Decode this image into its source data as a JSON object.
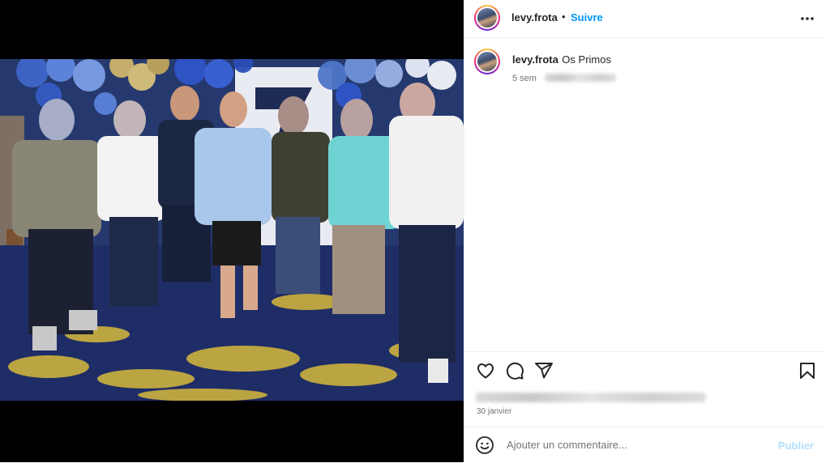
{
  "post": {
    "username": "levy.frota",
    "separator": "•",
    "follow_label": "Suivre",
    "more_icon": "more-horizontal-icon"
  },
  "caption": {
    "username": "levy.frota",
    "text": "Os Primos",
    "age": "5 sem"
  },
  "actions": {
    "like_icon": "heart-icon",
    "comment_icon": "comment-icon",
    "share_icon": "share-icon",
    "save_icon": "bookmark-icon"
  },
  "date": "30 janvier",
  "comment": {
    "placeholder": "Ajouter un commentaire...",
    "emoji_icon": "emoji-icon",
    "publish_label": "Publier"
  },
  "colors": {
    "accent": "#0095f6",
    "publish_disabled": "#b2dffc",
    "text": "#262626",
    "secondary": "#737373"
  }
}
